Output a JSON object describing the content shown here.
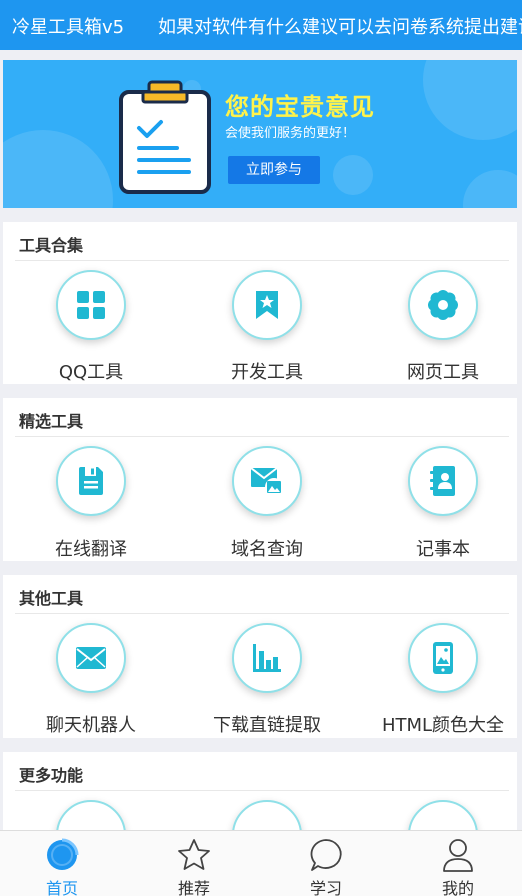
{
  "header": {
    "title": "冷星工具箱v5",
    "notice": "如果对软件有什么建议可以去问卷系统提出建议"
  },
  "banner": {
    "title": "您的宝贵意见",
    "subtitle": "会使我们服务的更好！",
    "button": "立即参与"
  },
  "sections": [
    {
      "title": "工具合集",
      "items": [
        {
          "label": "QQ工具",
          "icon": "grid-icon"
        },
        {
          "label": "开发工具",
          "icon": "bookmark-star-icon"
        },
        {
          "label": "网页工具",
          "icon": "flower-icon"
        }
      ]
    },
    {
      "title": "精选工具",
      "items": [
        {
          "label": "在线翻译",
          "icon": "save-icon"
        },
        {
          "label": "域名查询",
          "icon": "mail-image-icon"
        },
        {
          "label": "记事本",
          "icon": "contacts-book-icon"
        }
      ]
    },
    {
      "title": "其他工具",
      "items": [
        {
          "label": "聊天机器人",
          "icon": "envelope-icon"
        },
        {
          "label": "下载直链提取",
          "icon": "bar-chart-icon"
        },
        {
          "label": "HTML颜色大全",
          "icon": "phone-image-icon"
        }
      ]
    },
    {
      "title": "更多功能",
      "items": []
    }
  ],
  "tabs": [
    {
      "label": "首页",
      "icon": "home-icon",
      "active": true
    },
    {
      "label": "推荐",
      "icon": "star-icon",
      "active": false
    },
    {
      "label": "学习",
      "icon": "chat-bubble-icon",
      "active": false
    },
    {
      "label": "我的",
      "icon": "user-icon",
      "active": false
    }
  ],
  "colors": {
    "accent": "#1e96f0",
    "icon": "#20b8d2",
    "banner": "#33aef8",
    "banner_title": "#fff34a"
  }
}
